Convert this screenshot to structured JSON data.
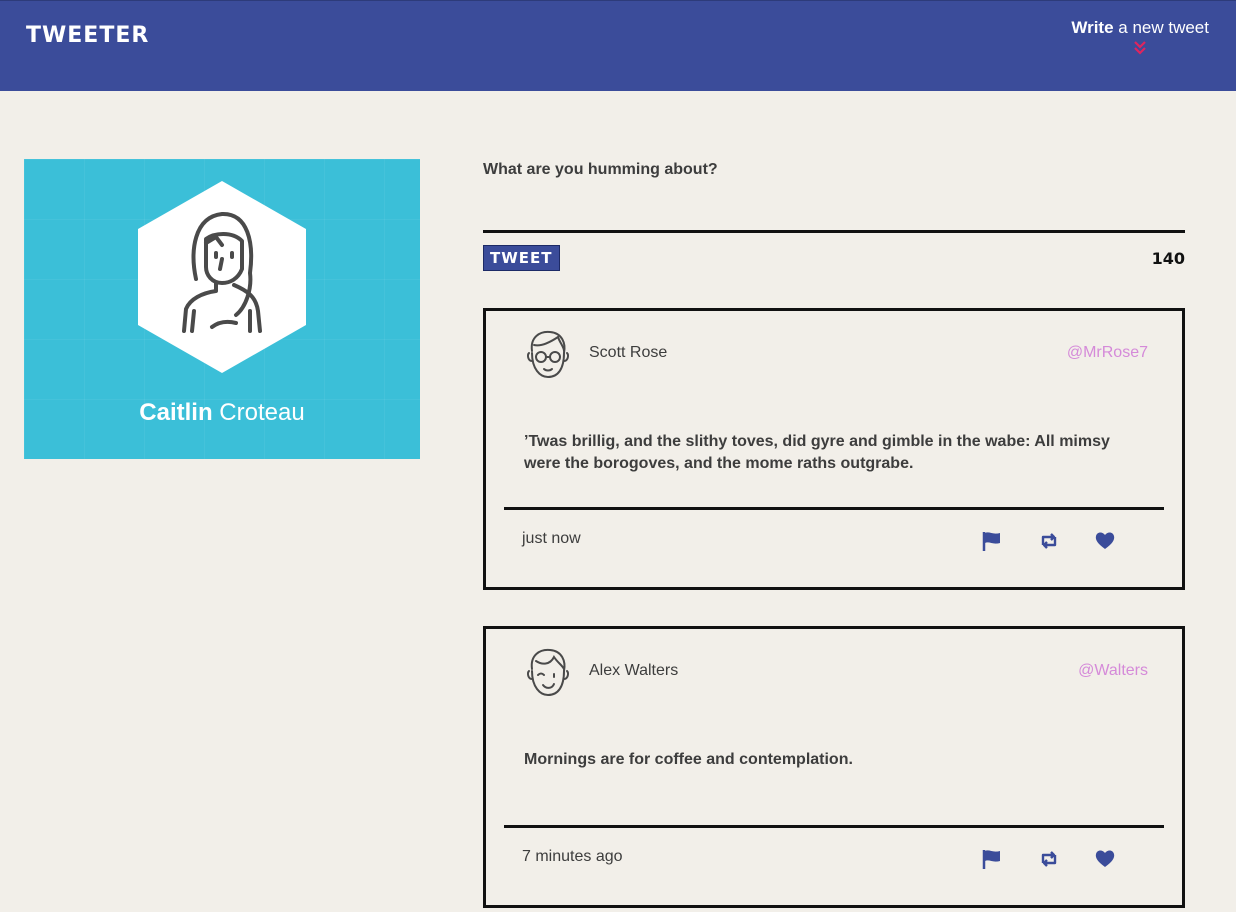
{
  "nav": {
    "brand": "TWEETER",
    "compose_bold": "Write",
    "compose_rest": " a new tweet",
    "arrow_icon": "double-chevron-down-icon",
    "accent_color": "#3b4c9a",
    "arrow_color": "#e0245e"
  },
  "profile": {
    "first_name": "Caitlin",
    "last_name": " Croteau",
    "bg_color": "#3bbfd8"
  },
  "composer": {
    "label": "What are you humming about?",
    "value": "",
    "button_label": "TWEET",
    "counter": "140"
  },
  "tweets": [
    {
      "name": "Scott Rose",
      "handle": "@MrRose7",
      "text": "’Twas brillig, and the slithy toves, did gyre and gimble in the wabe: All mimsy were the borogoves, and the mome raths outgrabe.",
      "time": "just now",
      "avatar_icon": "glasses-face-icon"
    },
    {
      "name": "Alex Walters",
      "handle": "@Walters",
      "text": "Mornings are for coffee and contemplation.",
      "time": "7 minutes ago",
      "avatar_icon": "winking-face-icon"
    }
  ],
  "actions": [
    "flag-icon",
    "retweet-icon",
    "heart-icon"
  ]
}
